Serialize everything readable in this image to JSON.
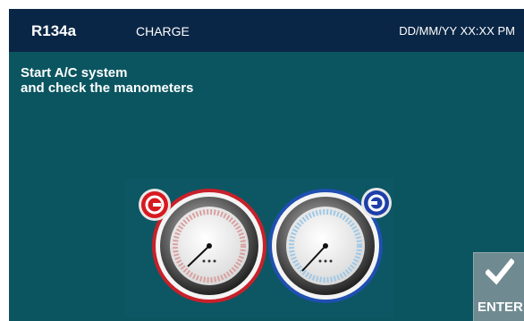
{
  "header": {
    "refrigerant": "R134a",
    "phase": "CHARGE",
    "datetime": "DD/MM/YY XX:XX PM"
  },
  "instruction": {
    "line1": "Start A/C system",
    "line2": "and check the manometers"
  },
  "gauges": {
    "low_pressure": {
      "color": "#c8202a",
      "icon": "low-pressure-connector-icon"
    },
    "high_pressure": {
      "color": "#1f4fb0",
      "icon": "high-pressure-connector-icon"
    }
  },
  "enter_button": {
    "label": "ENTER",
    "icon": "checkmark-icon"
  }
}
